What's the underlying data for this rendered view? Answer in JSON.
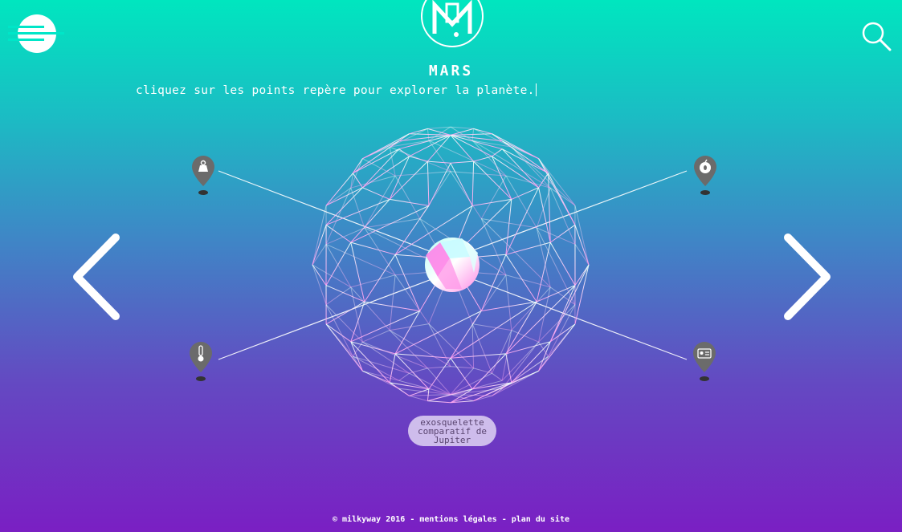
{
  "header": {
    "planet_name": "MARS",
    "instruction": "cliquez sur les points repère pour explorer la planète."
  },
  "caption": {
    "label": "exosquelette comparatif de Jupiter"
  },
  "footer": {
    "copyright": "© milkyway 2016",
    "separator": " - ",
    "mentions": "mentions légales",
    "sitemap": "plan du site"
  },
  "icons": {
    "menu": "hamburger-menu-icon",
    "logo": "milkyway-logo",
    "search": "search-icon",
    "prev": "chevron-left-icon",
    "next": "chevron-right-icon",
    "pin_weight": "weight-icon",
    "pin_core": "apple-icon",
    "pin_temperature": "thermometer-icon",
    "pin_id": "id-card-icon"
  },
  "colors": {
    "gradient_top": "#00e6bf",
    "gradient_bottom": "#7a1fc3",
    "pin": "#6b6b6b",
    "sphere_pink": "#ff88e8",
    "sphere_cyan": "#a8f4ff"
  }
}
